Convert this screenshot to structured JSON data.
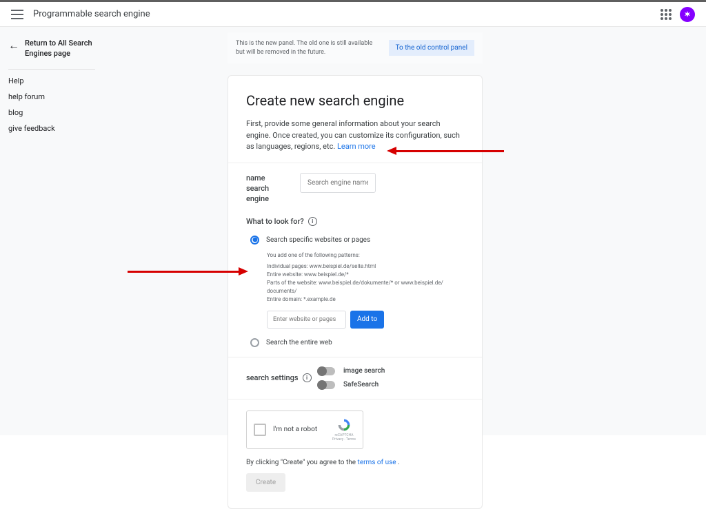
{
  "header": {
    "title": "Programmable search engine"
  },
  "sidebar": {
    "back_label": "Return to All Search Engines page",
    "items": [
      "Help",
      "help forum",
      "blog",
      "give feedback"
    ]
  },
  "notice": {
    "text": "This is the new panel. The old one is still available but will be removed in the future.",
    "button": "To the old control panel"
  },
  "card": {
    "title": "Create new search engine",
    "intro": "First, provide some general information about your search engine. Once created, you can customize its configuration, such as languages, regions, etc. ",
    "learn_more": "Learn more",
    "name_label": "name search engine",
    "name_placeholder": "Search engine name",
    "what_label": "What to look for?",
    "radio_specific": "Search specific websites or pages",
    "radio_entire": "Search the entire web",
    "pattern_intro": "You add one of the following patterns:",
    "patterns": "Individual pages: www.beispiel.de/seite.html\nEntire website: www.beispiel.de/*\nParts of the website: www.beispiel.de/dokumente/* or www.beispiel.de/ documents/\nEntire domain: *.example.de",
    "website_placeholder": "Enter website or pages",
    "add_button": "Add to",
    "settings_label": "search settings",
    "toggle_image": "image search",
    "toggle_safe": "SafeSearch",
    "recaptcha_text": "I'm not a robot",
    "recaptcha_brand": "reCAPTCHA",
    "recaptcha_links": "Privacy  -  Terms",
    "terms_prefix": "By clicking \"Create\" you agree to the ",
    "terms_link": "terms of use ",
    "terms_suffix": ".",
    "create_button": "Create"
  }
}
